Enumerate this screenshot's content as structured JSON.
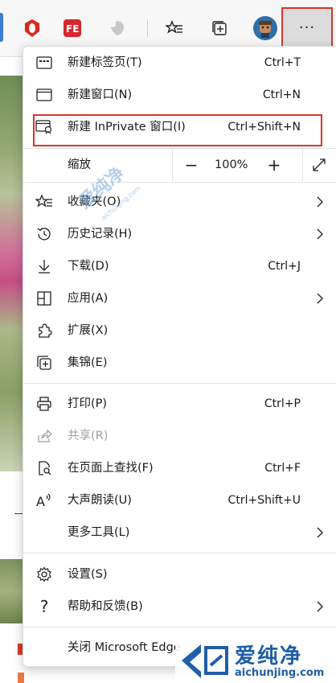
{
  "toolbar": {
    "more_label": "···"
  },
  "menu": {
    "new_tab": {
      "label": "新建标签页(T)",
      "shortcut": "Ctrl+T"
    },
    "new_window": {
      "label": "新建窗口(N)",
      "shortcut": "Ctrl+N"
    },
    "new_inprivate": {
      "label": "新建 InPrivate 窗口(I)",
      "shortcut": "Ctrl+Shift+N"
    },
    "zoom": {
      "label": "缩放",
      "value": "100%",
      "minus": "−",
      "plus": "+"
    },
    "favorites": {
      "label": "收藏夹(O)"
    },
    "history": {
      "label": "历史记录(H)"
    },
    "downloads": {
      "label": "下载(D)",
      "shortcut": "Ctrl+J"
    },
    "apps": {
      "label": "应用(A)"
    },
    "extensions": {
      "label": "扩展(X)"
    },
    "collections": {
      "label": "集锦(E)"
    },
    "print": {
      "label": "打印(P)",
      "shortcut": "Ctrl+P"
    },
    "share": {
      "label": "共享(R)",
      "disabled": true
    },
    "find": {
      "label": "在页面上查找(F)",
      "shortcut": "Ctrl+F"
    },
    "read_aloud": {
      "label": "大声朗读(U)",
      "shortcut": "Ctrl+Shift+U"
    },
    "more_tools": {
      "label": "更多工具(L)"
    },
    "settings": {
      "label": "设置(S)"
    },
    "help": {
      "label": "帮助和反馈(B)"
    },
    "close": {
      "label": "关闭 Microsoft Edge"
    }
  },
  "watermark": {
    "text": "爱纯净",
    "url": "aichunjing.com"
  },
  "colors": {
    "highlight": "#d9342b",
    "accent": "#3b7bd4"
  }
}
